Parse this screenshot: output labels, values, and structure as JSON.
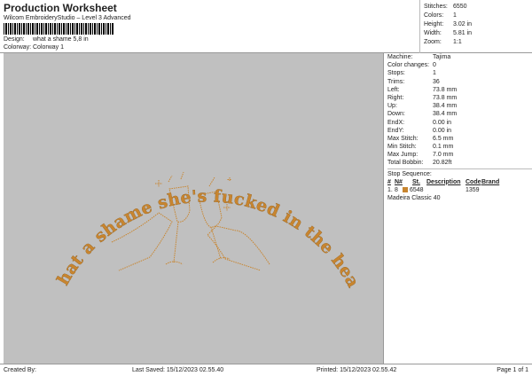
{
  "header": {
    "title": "Production Worksheet",
    "subtitle": "Wilcom EmbroideryStudio – Level 3 Advanced",
    "barcode_suffix": ",",
    "design_label": "Design:",
    "design_value": "what a shame 5,8 in",
    "colorway_label": "Colorway:",
    "colorway_value": "Colorway 1"
  },
  "stats": [
    {
      "k": "Stitches:",
      "v": "6550"
    },
    {
      "k": "Colors:",
      "v": "1"
    },
    {
      "k": "Height:",
      "v": "3.02 in"
    },
    {
      "k": "Width:",
      "v": "5.81 in"
    },
    {
      "k": "Zoom:",
      "v": "1:1"
    }
  ],
  "design": {
    "text": "what a shame she's fucked in the head",
    "thread_color": "#c8852f",
    "background": "#c0c0c0"
  },
  "details": [
    {
      "k": "Machine:",
      "v": "Tajima"
    },
    {
      "k": "Color changes:",
      "v": "0"
    },
    {
      "k": "Stops:",
      "v": "1"
    },
    {
      "k": "Trims:",
      "v": "36"
    },
    {
      "k": "Left:",
      "v": "73.8 mm"
    },
    {
      "k": "Right:",
      "v": "73.8 mm"
    },
    {
      "k": "Up:",
      "v": "38.4 mm"
    },
    {
      "k": "Down:",
      "v": "38.4 mm"
    },
    {
      "k": "EndX:",
      "v": "0.00 in"
    },
    {
      "k": "EndY:",
      "v": "0.00 in"
    },
    {
      "k": "Max Stitch:",
      "v": "6.5 mm"
    },
    {
      "k": "Min Stitch:",
      "v": "0.1 mm"
    },
    {
      "k": "Max Jump:",
      "v": "7.0 mm"
    },
    {
      "k": "Total Bobbin:",
      "v": "20.82ft"
    }
  ],
  "stop_sequence": {
    "title": "Stop Sequence:",
    "headers": [
      "#",
      "N#",
      "St.",
      "Description",
      "Code",
      "Brand"
    ],
    "rows": [
      {
        "num": "1.",
        "n": "8",
        "st": "6548",
        "desc": "",
        "code": "1359",
        "brand": "Madeira Classic 40"
      }
    ]
  },
  "footer": {
    "created": "Created By:",
    "saved": "Last Saved: 15/12/2023 02.55.40",
    "printed": "Printed: 15/12/2023 02.55.42",
    "page": "Page 1 of 1"
  }
}
